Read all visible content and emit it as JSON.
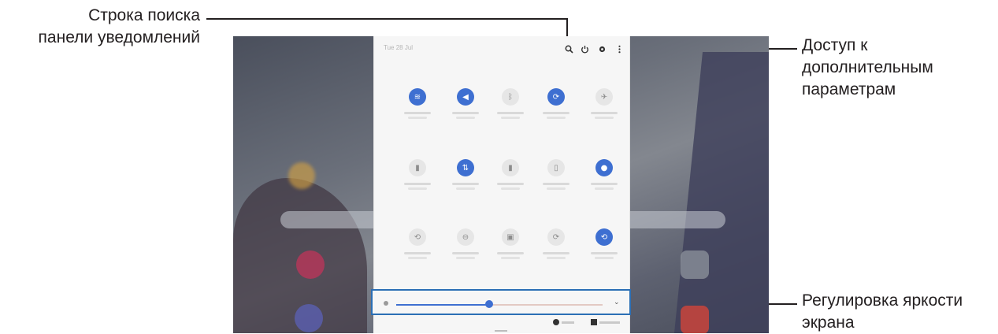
{
  "callouts": {
    "search": {
      "line1": "Строка поиска",
      "line2": "панели уведомлений"
    },
    "more_options": {
      "line1": "Доступ к",
      "line2": "дополнительным",
      "line3": "параметрам"
    },
    "brightness": {
      "line1": "Регулировка яркости",
      "line2": "экрана"
    }
  },
  "quick_panel": {
    "title": "Tue 28 Jul",
    "top_icons": [
      "search-icon",
      "power-icon",
      "gear-icon",
      "more-options-icon"
    ],
    "tiles": [
      {
        "icon": "wifi-icon",
        "on": true
      },
      {
        "icon": "sound-icon",
        "on": true
      },
      {
        "icon": "bluetooth-icon",
        "on": false
      },
      {
        "icon": "auto-rotate-icon",
        "on": true
      },
      {
        "icon": "airplane-mode-icon",
        "on": false
      },
      {
        "icon": "power-saving-icon",
        "on": false
      },
      {
        "icon": "mobile-data-icon",
        "on": true
      },
      {
        "icon": "flashlight-icon",
        "on": false
      },
      {
        "icon": "screen-record-icon",
        "on": false
      },
      {
        "icon": "location-icon",
        "on": true
      },
      {
        "icon": "sync-icon",
        "on": false
      },
      {
        "icon": "do-not-disturb-icon",
        "on": false
      },
      {
        "icon": "screen-capture-icon",
        "on": false
      },
      {
        "icon": "refresh-icon",
        "on": false
      },
      {
        "icon": "auto-sync-icon",
        "on": true
      }
    ],
    "page_indicator": {
      "current": 1,
      "total": 2
    },
    "brightness_level": 0.45,
    "colors": {
      "accent": "#3e6fd1",
      "callout_border": "#2b6fb5"
    }
  }
}
